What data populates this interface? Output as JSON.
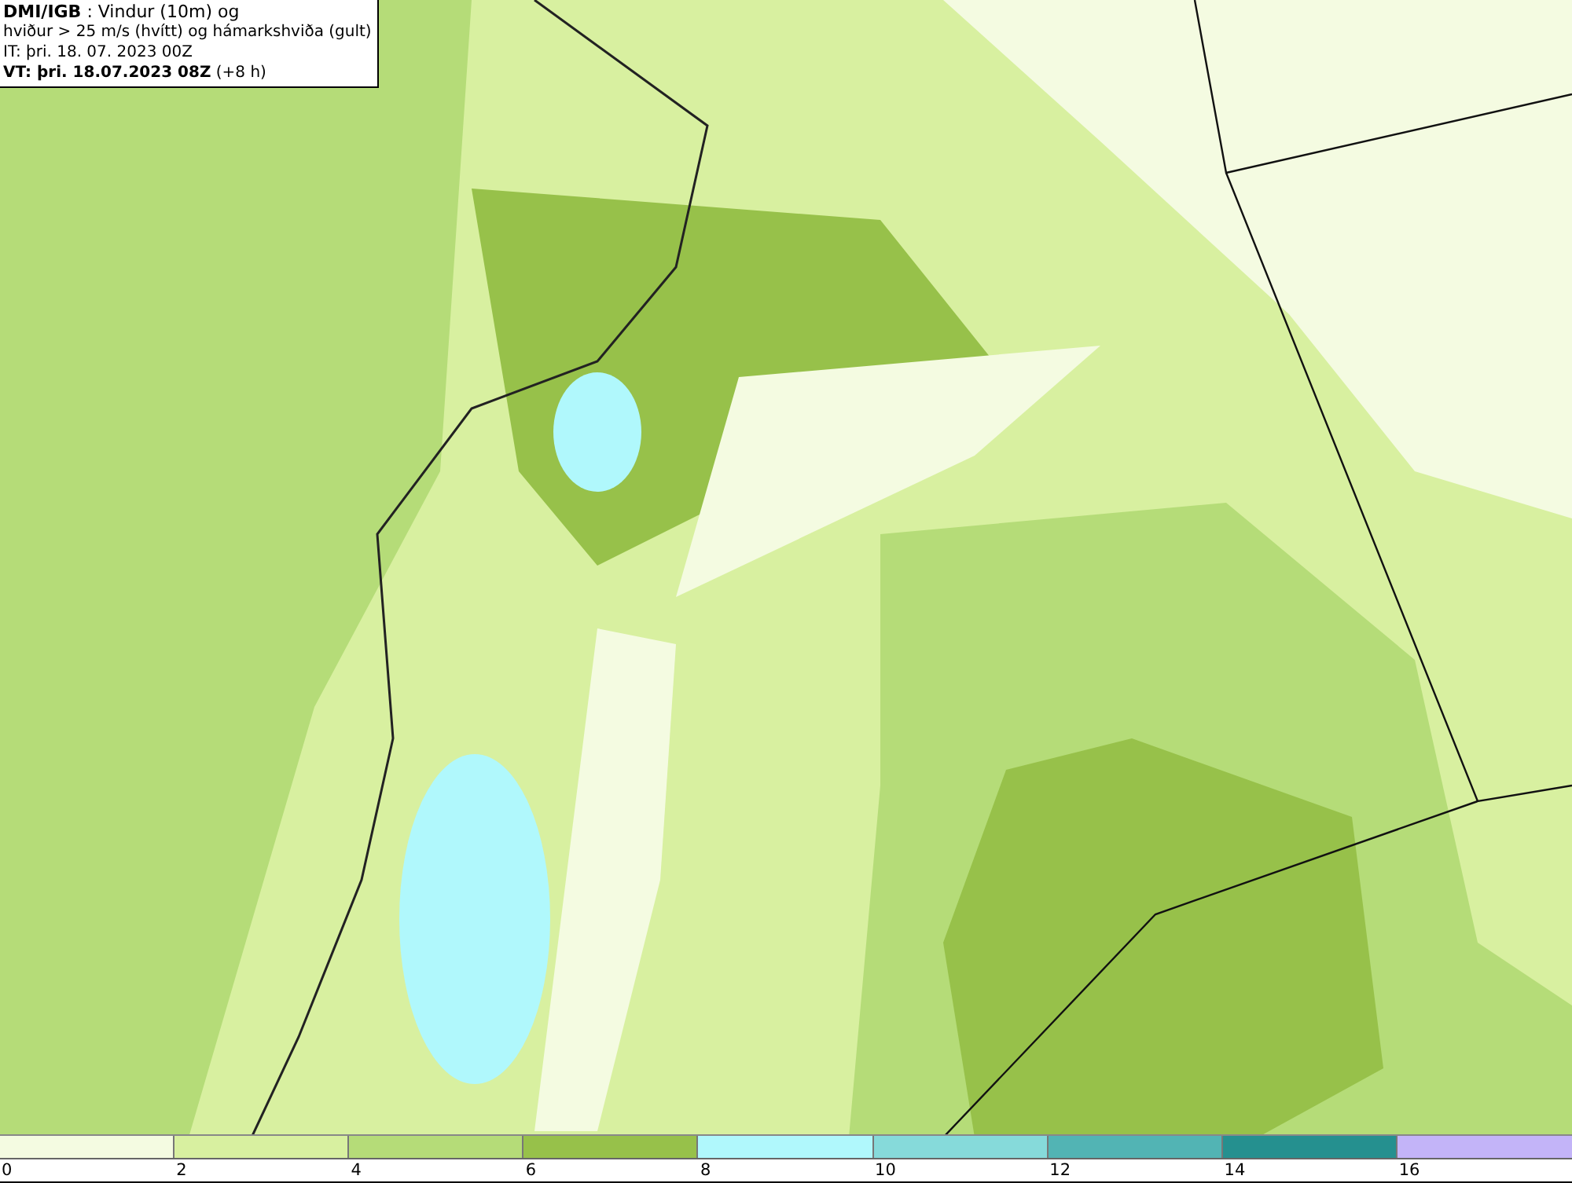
{
  "legend": {
    "lines": [
      "**DMI/IGB** : Vindur (10m) og",
      "hviður > 25 m/s (hvítt) og hámarkshviða (gult)",
      "IT: þri. 18. 07. 2023 00Z",
      "**VT: þri. 18.07.2023 08Z** (+8 h)"
    ]
  },
  "colorbar": {
    "segments": [
      {
        "color": "#f4fbe1"
      },
      {
        "color": "#d8f0a0"
      },
      {
        "color": "#b5dc78"
      },
      {
        "color": "#97c14a"
      },
      {
        "color": "#b0f8fc"
      },
      {
        "color": "#86dada"
      },
      {
        "color": "#52b4b4"
      },
      {
        "color": "#25908f"
      },
      {
        "color": "#c3b4f8"
      }
    ],
    "ticks": [
      "0",
      "2",
      "4",
      "6",
      "8",
      "10",
      "12",
      "14",
      "16"
    ]
  }
}
